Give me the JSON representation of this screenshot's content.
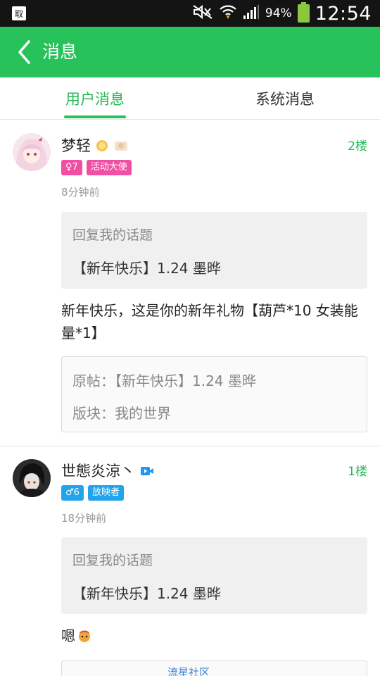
{
  "status_bar": {
    "battery_pct": "94%",
    "time": "12:54"
  },
  "header": {
    "title": "消息"
  },
  "tabs": [
    {
      "label": "用户消息",
      "active": true
    },
    {
      "label": "系统消息",
      "active": false
    }
  ],
  "messages": [
    {
      "username": "梦轻",
      "floor": "2楼",
      "gender_badge": "♀7",
      "role_badge": "活动大使",
      "time": "8分钟前",
      "quote_title": "回复我的话题",
      "quote_text": "【新年快乐】1.24 墨晔",
      "content": "新年快乐，这是你的新年礼物【葫芦*10 女装能量*1】",
      "source_post": "原帖：【新年快乐】1.24 墨晔",
      "source_board": "版块：我的世界"
    },
    {
      "username": "世態炎涼丶",
      "floor": "1楼",
      "gender_badge": "♂6",
      "role_badge": "放映者",
      "time": "18分钟前",
      "quote_title": "回复我的话题",
      "quote_text": "【新年快乐】1.24 墨晔",
      "content": "嗯"
    }
  ],
  "watermark": "流星社区",
  "colors": {
    "accent": "#27c25a",
    "female_badge": "#f04fa3",
    "male_badge": "#22a4ea",
    "status_bar": "#141414"
  }
}
